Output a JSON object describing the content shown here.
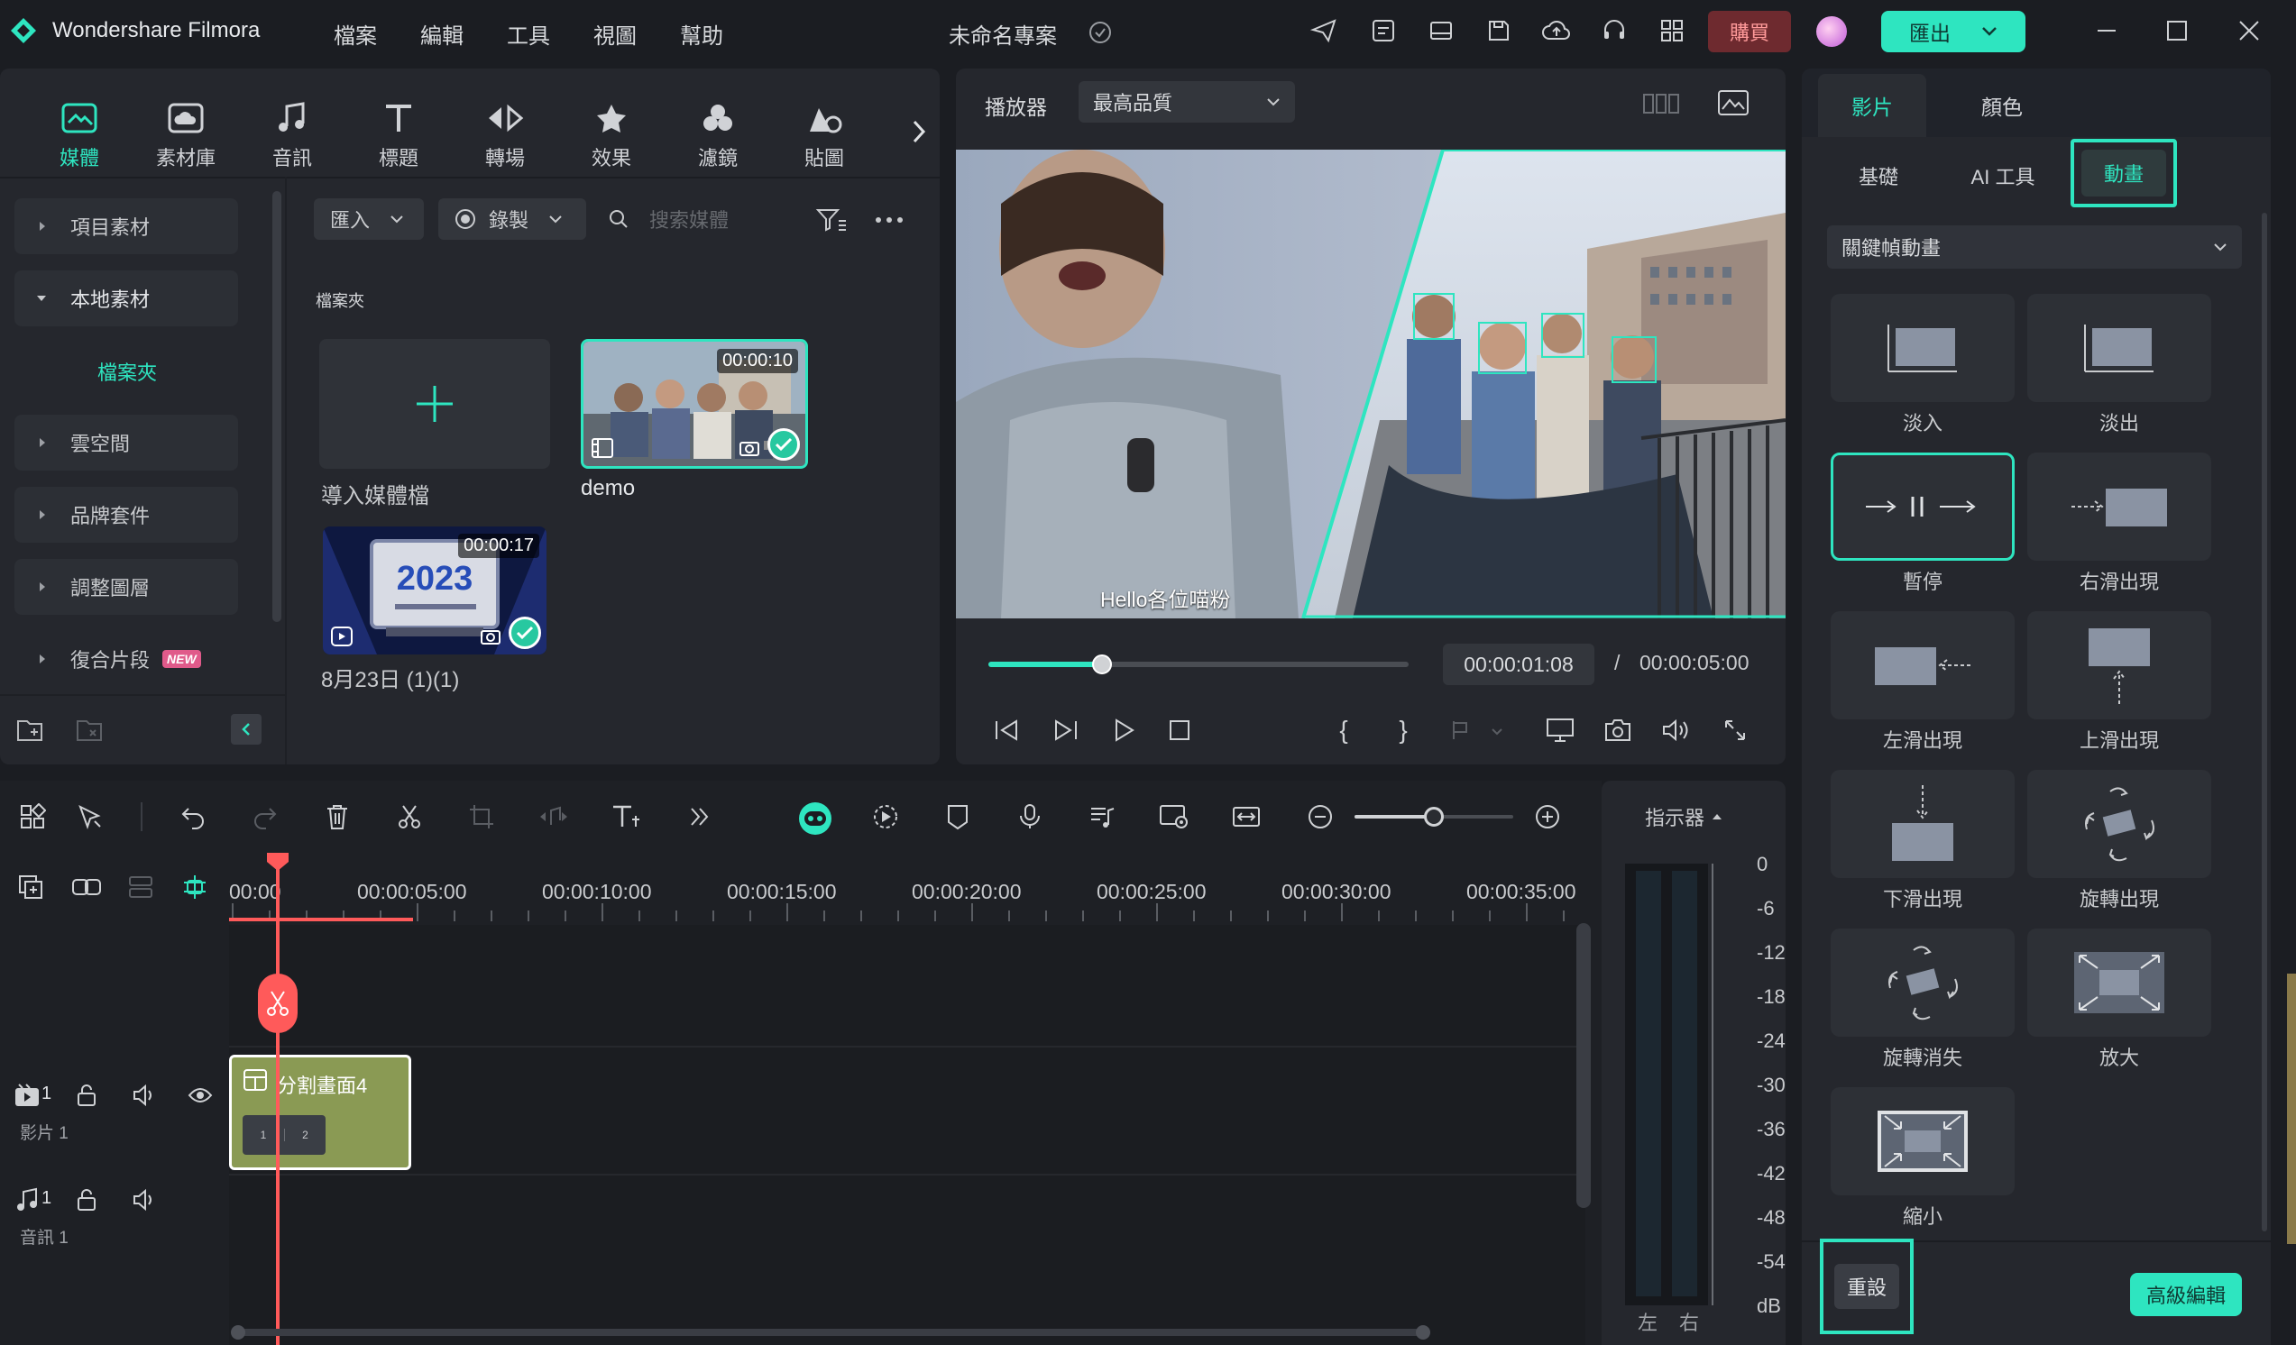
{
  "app": {
    "name": "Wondershare Filmora",
    "project_title": "未命名專案"
  },
  "menu": [
    "檔案",
    "編輯",
    "工具",
    "視圖",
    "幫助"
  ],
  "header": {
    "buy_label": "購買",
    "export_label": "匯出"
  },
  "media_tabs": [
    "媒體",
    "素材庫",
    "音訊",
    "標題",
    "轉場",
    "效果",
    "濾鏡",
    "貼圖"
  ],
  "sidebar": {
    "items": [
      "項目素材",
      "本地素材",
      "檔案夾",
      "雲空間",
      "品牌套件",
      "調整圖層",
      "復合片段"
    ],
    "new_badge": "NEW"
  },
  "media_toolbar": {
    "import_label": "匯入",
    "record_label": "錄製",
    "search_placeholder": "搜索媒體"
  },
  "media": {
    "folder_heading": "檔案夾",
    "import_tile_label": "導入媒體檔",
    "clips": [
      {
        "name": "demo",
        "duration": "00:00:10"
      },
      {
        "name": "8月23日 (1)(1)",
        "duration": "00:00:17"
      }
    ]
  },
  "player": {
    "label": "播放器",
    "quality": "最高品質",
    "subtitle": "Hello各位喵粉",
    "current_time": "00:00:01:08",
    "separator": "/",
    "total_time": "00:00:05:00",
    "progress": 0.27
  },
  "right_panel": {
    "tabs": [
      "影片",
      "顏色"
    ],
    "subtabs": [
      "基礎",
      "AI 工具",
      "動畫"
    ],
    "dropdown": "關鍵幀動畫",
    "animations": [
      "淡入",
      "淡出",
      "暫停",
      "右滑出現",
      "左滑出現",
      "上滑出現",
      "下滑出現",
      "旋轉出現",
      "旋轉消失",
      "放大",
      "縮小"
    ],
    "reset_label": "重設",
    "advanced_label": "高級編輯"
  },
  "timeline": {
    "ruler": [
      "00:00",
      "00:00:05:00",
      "00:00:10:00",
      "00:00:15:00",
      "00:00:20:00",
      "00:00:25:00",
      "00:00:30:00",
      "00:00:35:00"
    ],
    "clip_label": "分割畫面4",
    "clip_sub": [
      "1",
      "2"
    ],
    "video_track": {
      "num": "1",
      "name": "影片 1"
    },
    "audio_track": {
      "num": "1",
      "name": "音訊 1"
    },
    "zoom": 0.5
  },
  "meter": {
    "label": "指示器",
    "scale": [
      "0",
      "-6",
      "-12",
      "-18",
      "-24",
      "-30",
      "-36",
      "-42",
      "-48",
      "-54",
      "dB"
    ],
    "channels": [
      "左",
      "右"
    ]
  },
  "colors": {
    "accent": "#2ee5c0",
    "playhead": "#ff5a5a",
    "buy": "#7a2a2f",
    "clip": "#8a9a54"
  }
}
